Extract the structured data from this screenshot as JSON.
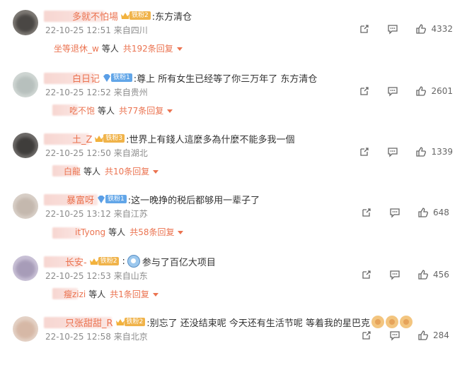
{
  "comments": [
    {
      "name": "多就不怕場",
      "badge_type": "gold",
      "badge_label": "铁粉2",
      "text": ":东方清仓",
      "time": "22-10-25 12:51",
      "location": "来自四川",
      "likes": "4332",
      "reply_user": "坐等退休_w",
      "reply_deng": "等人",
      "reply_total": "共192条回复"
    },
    {
      "name": "白日记",
      "badge_type": "blue",
      "badge_label": "铁粉1",
      "text": ":尊上 所有女生已经等了你三万年了 东方清仓",
      "time": "22-10-25 12:52",
      "location": "来自贵州",
      "likes": "2601",
      "reply_user": "吃不饱",
      "reply_deng": "等人",
      "reply_total": "共77条回复"
    },
    {
      "name": "土_Z",
      "badge_type": "gold",
      "badge_label": "铁粉3",
      "text": ":世界上有錢人這麼多為什麼不能多我一個",
      "time": "22-10-25 12:50",
      "location": "来自湖北",
      "likes": "1339",
      "reply_user": "白龍",
      "reply_deng": "等人",
      "reply_total": "共10条回复"
    },
    {
      "name": "暴富呀",
      "badge_type": "blue",
      "badge_label": "铁粉1",
      "text": ":这一晚挣的税后都够用一辈子了",
      "time": "22-10-25 13:12",
      "location": "来自江苏",
      "likes": "648",
      "reply_user": "itTyong",
      "reply_deng": "等人",
      "reply_total": "共58条回复"
    },
    {
      "name": "长安-",
      "badge_type": "gold",
      "badge_label": "铁粉2",
      "text": "参与了百亿大项目",
      "time": "22-10-25 12:53",
      "location": "来自山东",
      "likes": "456",
      "reply_user": "瘦zizi",
      "reply_deng": "等人",
      "reply_total": "共1条回复"
    },
    {
      "name": "只张甜甜_R",
      "badge_type": "gold",
      "badge_label": "铁粉2",
      "text": ":别忘了 还没结束呢 今天还有生活节呢 等着我的星巴克",
      "time": "22-10-25 12:58",
      "location": "来自北京",
      "likes": "284"
    }
  ]
}
